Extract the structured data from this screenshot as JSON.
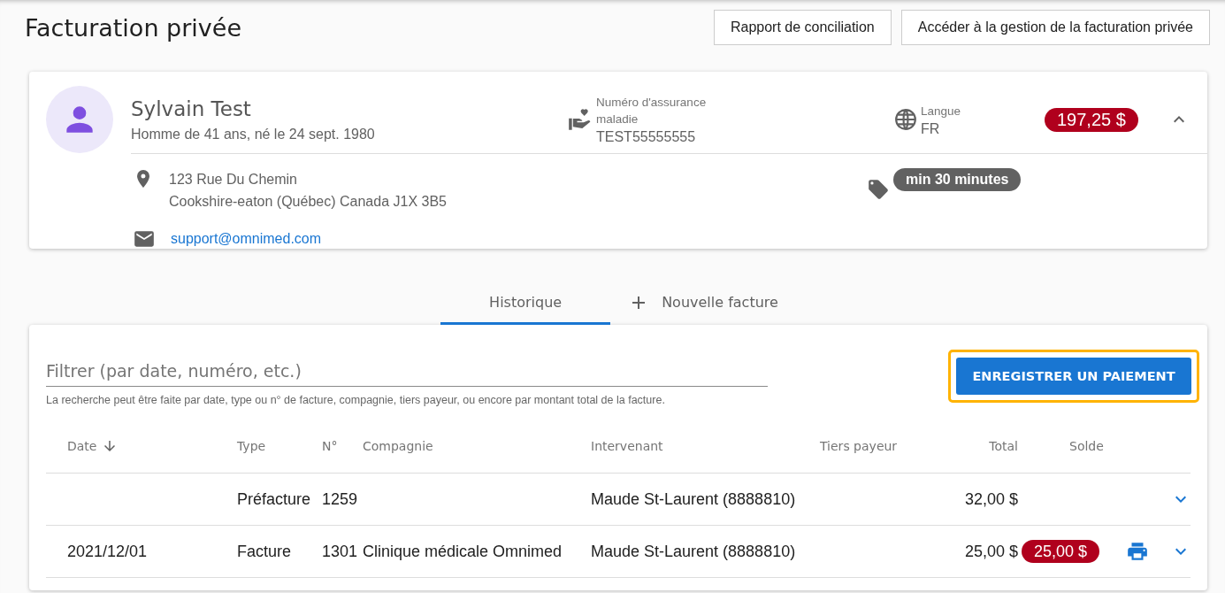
{
  "page_title": "Facturation privée",
  "header_buttons": [
    "Rapport de conciliation",
    "Accéder à la gestion de la facturation privée"
  ],
  "patient": {
    "name": "Sylvain Test",
    "summary": "Homme de 41 ans, né le 24 sept. 1980",
    "insurance": {
      "label": "Numéro d'assurance maladie",
      "value": "TEST55555555"
    },
    "language": {
      "label": "Langue",
      "value": "FR"
    },
    "balance": "197,25 $",
    "expanded": true,
    "address": [
      "123 Rue Du Chemin",
      "Cookshire-eaton (Québec) Canada J1X 3B5"
    ],
    "email": "support@omnimed.com",
    "tags": [
      "min 30 minutes"
    ]
  },
  "tabs": [
    {
      "label": "Historique",
      "selected": true,
      "kind": "plain"
    },
    {
      "label": "Nouvelle facture",
      "selected": false,
      "kind": "add"
    }
  ],
  "filter": {
    "placeholder": "Filtrer (par date, numéro, etc.)",
    "hint": "La recherche peut être faite par date, type ou n° de facture, compagnie, tiers payeur, ou encore par montant total de la facture."
  },
  "payment_button": {
    "label": "ENREGISTRER UN PAIEMENT",
    "focused": true
  },
  "table": {
    "columns": [
      {
        "label": "Date",
        "sorted": true
      },
      {
        "label": "Type",
        "sorted": false
      },
      {
        "label": "N°",
        "sorted": false
      },
      {
        "label": "Compagnie",
        "sorted": false
      },
      {
        "label": "Intervenant",
        "sorted": false
      },
      {
        "label": "Tiers payeur",
        "sorted": false
      },
      {
        "label": "Total",
        "sorted": false
      },
      {
        "label": "Solde",
        "sorted": false
      }
    ],
    "rows": [
      {
        "date": "",
        "type": "Préfacture",
        "number": "1259",
        "company": "",
        "provider": "Maude St-Laurent (8888810)",
        "third_party": "",
        "total": "32,00 $",
        "balance": "",
        "printable": false,
        "expanded": false
      },
      {
        "date": "2021/12/01",
        "type": "Facture",
        "number": "1301",
        "company": "Clinique médicale Omnimed",
        "provider": "Maude St-Laurent (8888810)",
        "third_party": "",
        "total": "25,00 $",
        "balance": "25,00 $",
        "printable": true,
        "expanded": false
      }
    ]
  }
}
